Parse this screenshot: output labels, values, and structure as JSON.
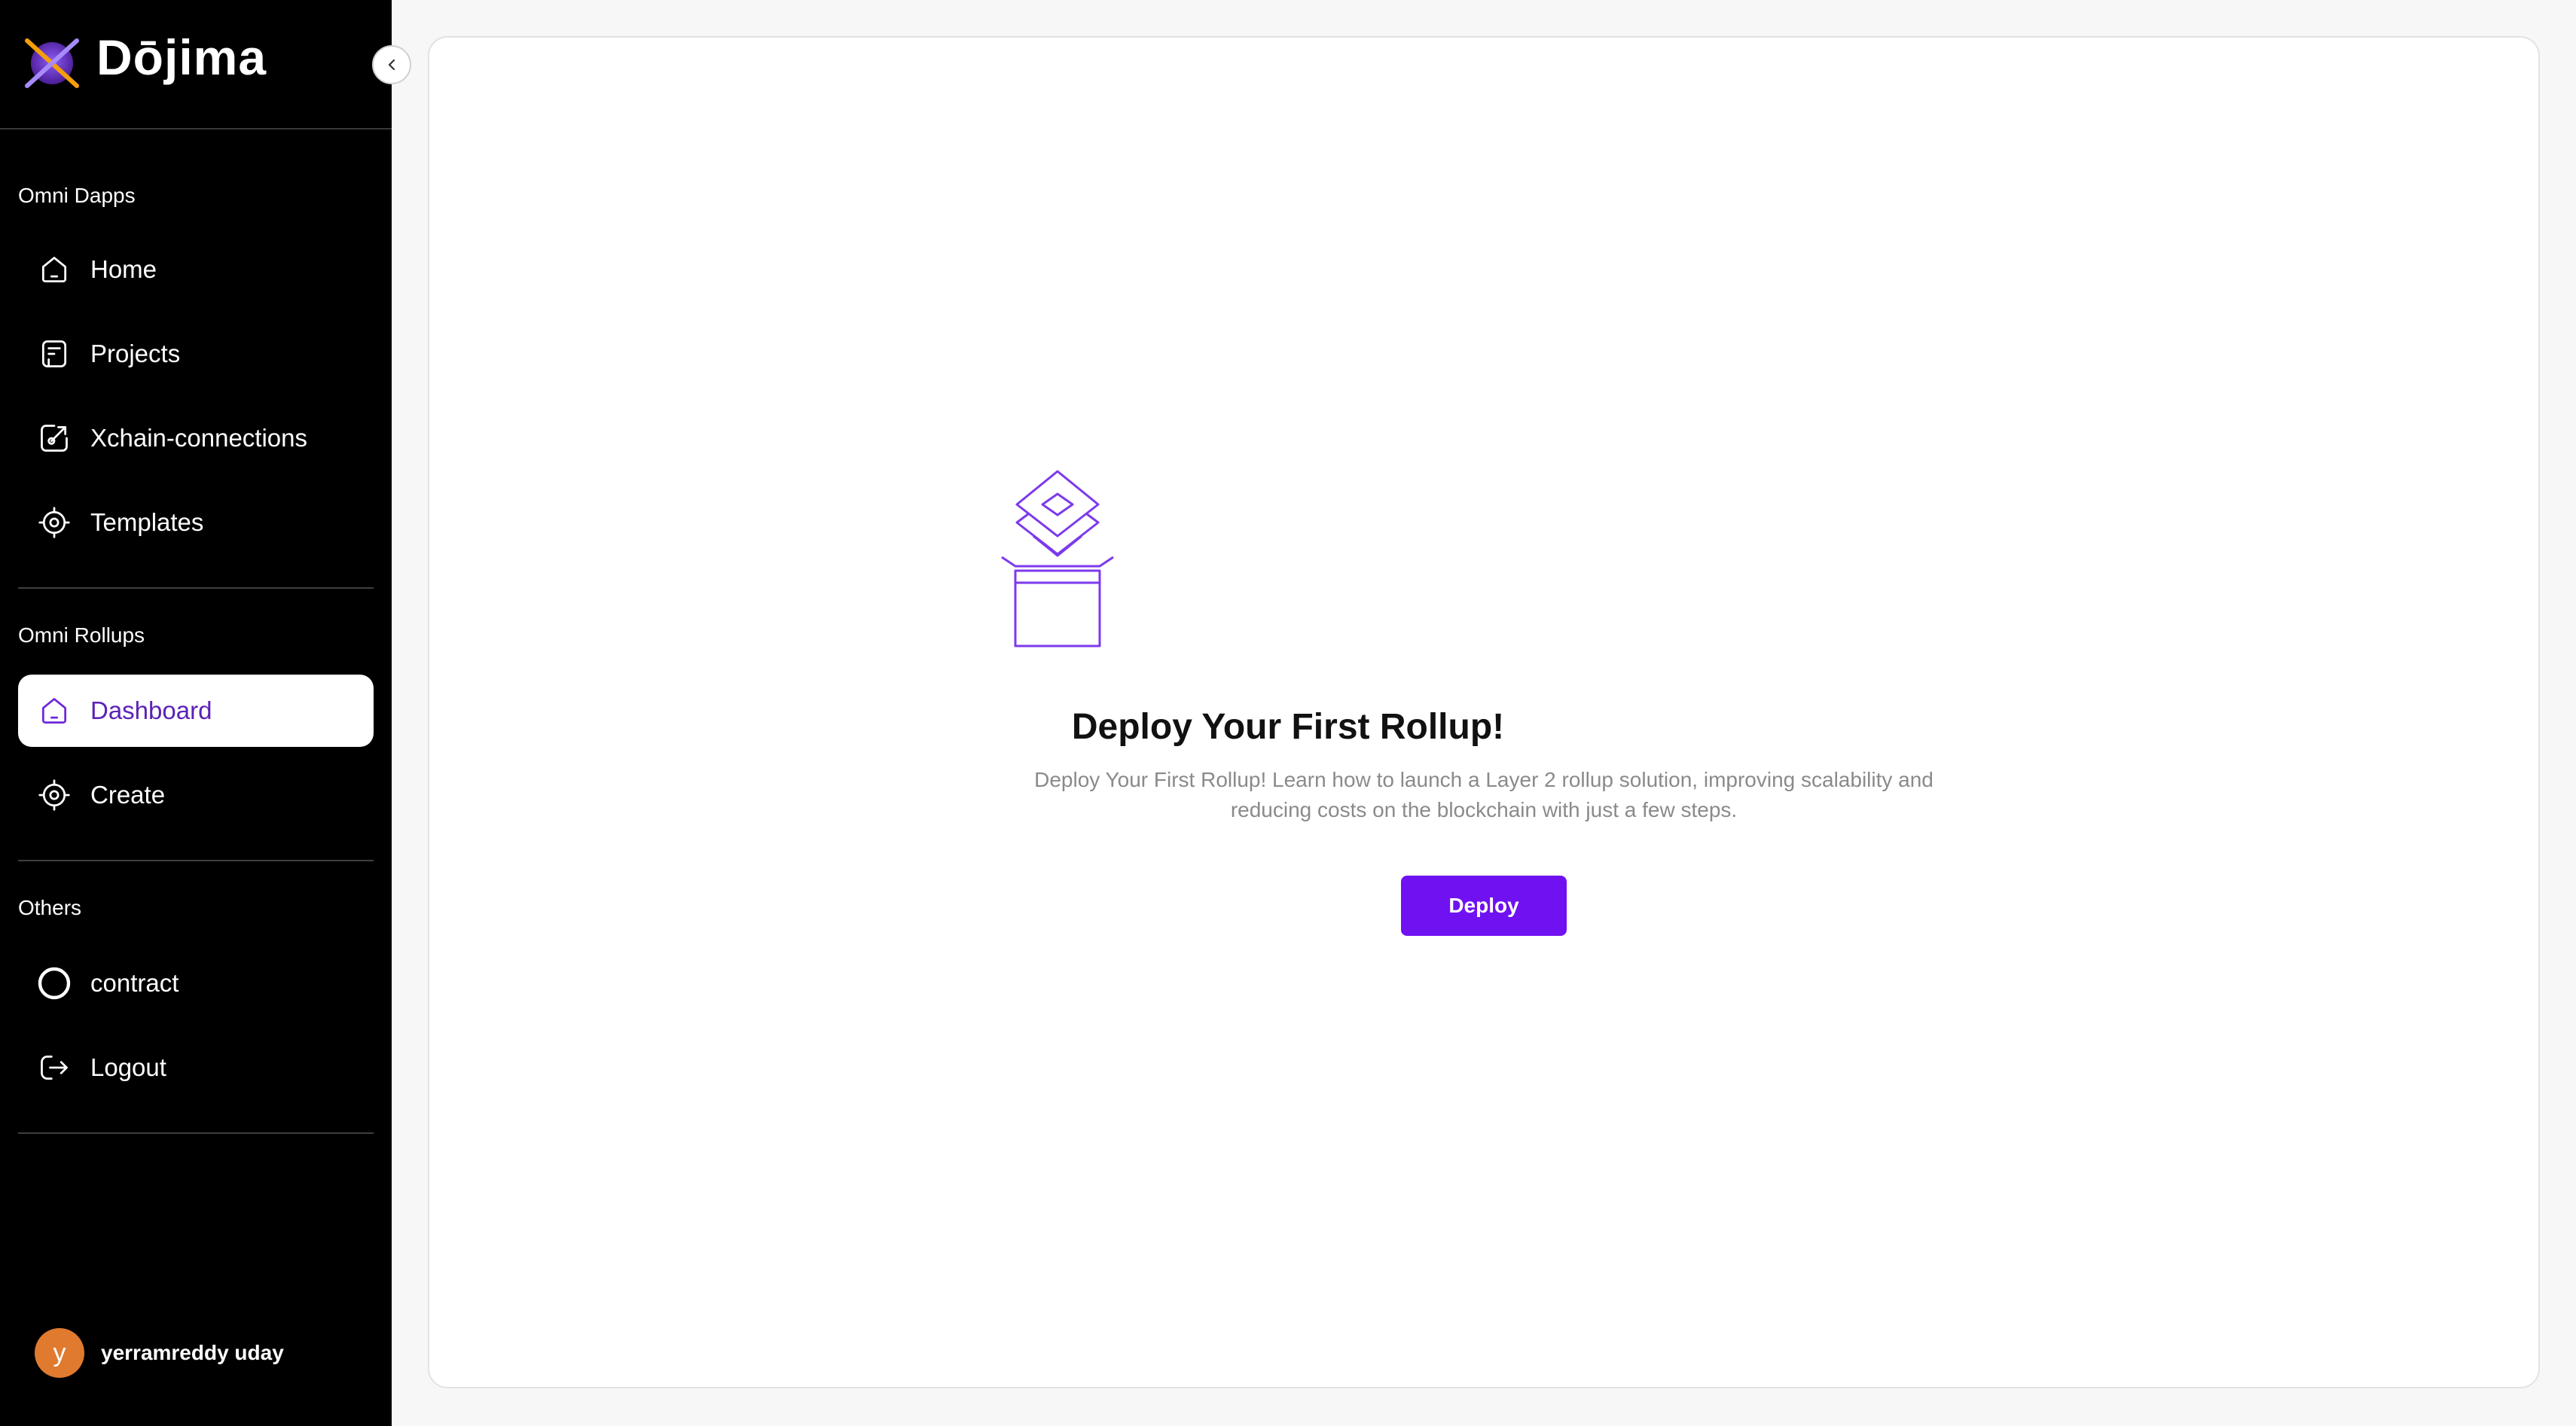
{
  "brand": {
    "name": "Dōjima"
  },
  "sidebar": {
    "sections": [
      {
        "label": "Omni Dapps",
        "items": [
          {
            "label": "Home",
            "icon": "home-icon",
            "active": false
          },
          {
            "label": "Projects",
            "icon": "projects-icon",
            "active": false
          },
          {
            "label": "Xchain-connections",
            "icon": "link-edit-icon",
            "active": false
          },
          {
            "label": "Templates",
            "icon": "target-icon",
            "active": false
          }
        ]
      },
      {
        "label": "Omni Rollups",
        "items": [
          {
            "label": "Dashboard",
            "icon": "home-icon",
            "active": true
          },
          {
            "label": "Create",
            "icon": "target-icon",
            "active": false
          }
        ]
      },
      {
        "label": "Others",
        "items": [
          {
            "label": "contract",
            "icon": "circle-icon",
            "active": false
          },
          {
            "label": "Logout",
            "icon": "logout-icon",
            "active": false
          }
        ]
      }
    ],
    "user": {
      "initial": "y",
      "name": "yerramreddy uday"
    }
  },
  "main": {
    "empty_state": {
      "title": "Deploy Your First Rollup!",
      "description": "Deploy Your First Rollup! Learn how to launch a Layer 2 rollup solution, improving scalability and reducing costs on the blockchain with just a few steps.",
      "button_label": "Deploy"
    }
  },
  "colors": {
    "accent": "#7011f2",
    "active_text": "#5b21b6",
    "sidebar_bg": "#000000",
    "avatar": "#e07a2e"
  }
}
